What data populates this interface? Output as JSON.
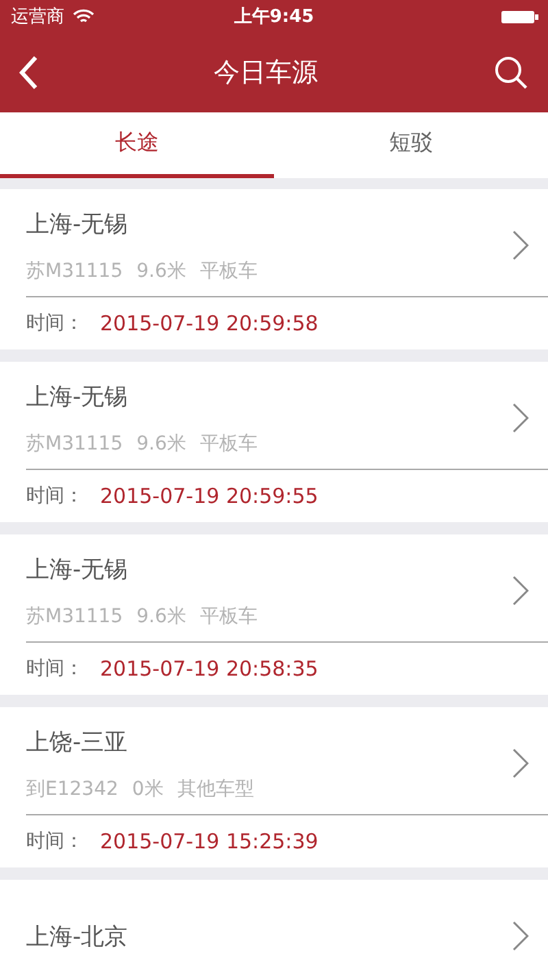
{
  "status_bar": {
    "carrier": "运营商",
    "time": "上午9:45"
  },
  "nav": {
    "title": "今日车源"
  },
  "tabs": [
    {
      "label": "长途",
      "selected": true
    },
    {
      "label": "短驳",
      "selected": false
    }
  ],
  "cards": [
    {
      "route": "上海-无锡",
      "details": [
        "苏M31115",
        "9.6米",
        "平板车"
      ],
      "time_label": "时间：",
      "time": "2015-07-19 20:59:58"
    },
    {
      "route": "上海-无锡",
      "details": [
        "苏M31115",
        "9.6米",
        "平板车"
      ],
      "time_label": "时间：",
      "time": "2015-07-19 20:59:55"
    },
    {
      "route": "上海-无锡",
      "details": [
        "苏M31115",
        "9.6米",
        "平板车"
      ],
      "time_label": "时间：",
      "time": "2015-07-19 20:58:35"
    },
    {
      "route": "上饶-三亚",
      "details": [
        "到E12342",
        "0米",
        "其他车型"
      ],
      "time_label": "时间：",
      "time": "2015-07-19 15:25:39"
    },
    {
      "route": "上海-北京"
    }
  ]
}
